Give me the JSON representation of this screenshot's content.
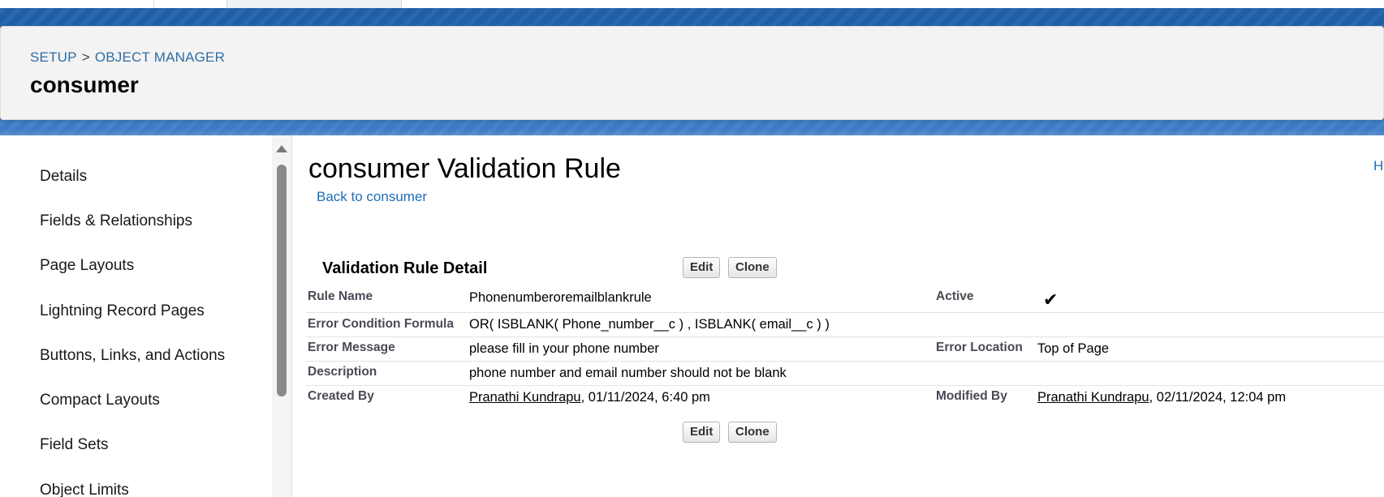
{
  "breadcrumb": {
    "setup": "SETUP",
    "separator": ">",
    "object_manager": "OBJECT MANAGER"
  },
  "object_title": "consumer",
  "sidebar": {
    "items": [
      {
        "label": "Details"
      },
      {
        "label": "Fields & Relationships"
      },
      {
        "label": "Page Layouts"
      },
      {
        "label": "Lightning Record Pages"
      },
      {
        "label": "Buttons, Links, and Actions"
      },
      {
        "label": "Compact Layouts"
      },
      {
        "label": "Field Sets"
      },
      {
        "label": "Object Limits"
      }
    ]
  },
  "main": {
    "title": "consumer Validation Rule",
    "back_link": "Back to consumer",
    "help_link_partial": "H",
    "section_title": "Validation Rule Detail",
    "edit_label": "Edit",
    "clone_label": "Clone",
    "fields": {
      "rule_name_label": "Rule Name",
      "rule_name_value": "Phonenumberoremailblankrule",
      "active_label": "Active",
      "active_value": "✔",
      "formula_label": "Error Condition Formula",
      "formula_value": "OR( ISBLANK( Phone_number__c ) , ISBLANK( email__c ) )",
      "error_message_label": "Error Message",
      "error_message_value": "please fill in your phone number",
      "error_location_label": "Error Location",
      "error_location_value": "Top of Page",
      "description_label": "Description",
      "description_value": "phone number and email number should not be blank",
      "created_by_label": "Created By",
      "created_by_user": "Pranathi Kundrapu",
      "created_by_date": ", 01/11/2024, 6:40 pm",
      "modified_by_label": "Modified By",
      "modified_by_user": "Pranathi Kundrapu",
      "modified_by_date": ", 02/11/2024, 12:04 pm"
    }
  },
  "colors": {
    "brand_blue": "#2a64a8",
    "link_blue": "#1f6eb5"
  }
}
